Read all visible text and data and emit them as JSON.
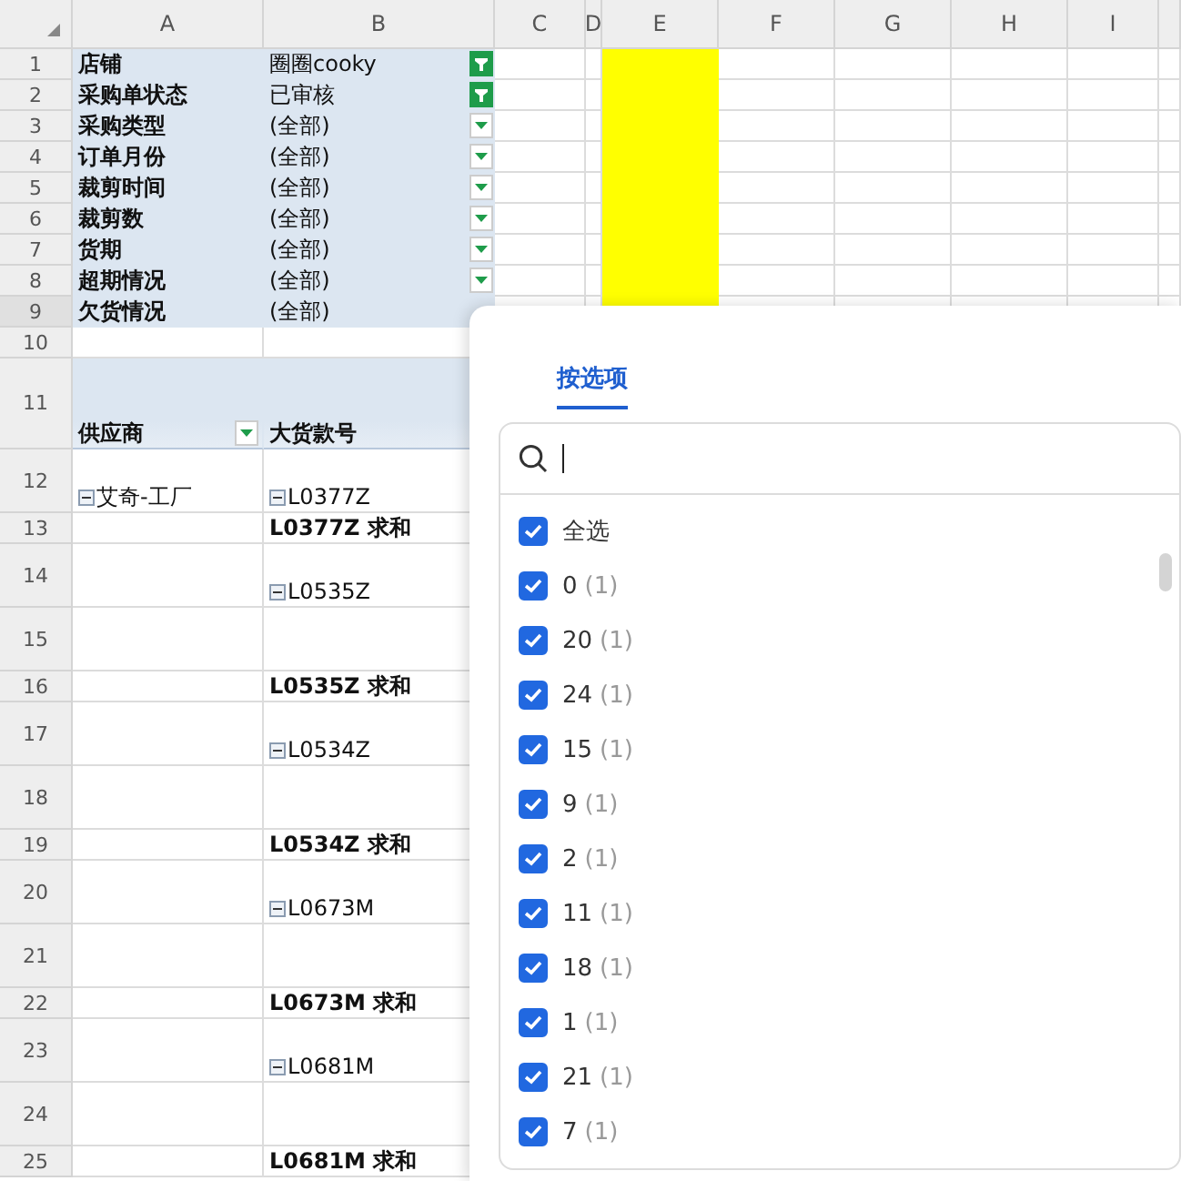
{
  "columns": [
    "A",
    "B",
    "C",
    "D",
    "E",
    "F",
    "G",
    "H",
    "I"
  ],
  "rows": [
    {
      "num": "1",
      "kind": "filter",
      "a": "店铺",
      "b": "圈圈cooky",
      "filtered": true,
      "highlighted": true,
      "selected": false
    },
    {
      "num": "2",
      "kind": "filter",
      "a": "采购单状态",
      "b": "已审核",
      "filtered": true,
      "highlighted": true,
      "selected": false
    },
    {
      "num": "3",
      "kind": "filter",
      "a": "采购类型",
      "b": "(全部)",
      "filtered": false,
      "highlighted": true,
      "selected": false
    },
    {
      "num": "4",
      "kind": "filter",
      "a": "订单月份",
      "b": "(全部)",
      "filtered": false,
      "highlighted": true,
      "selected": false
    },
    {
      "num": "5",
      "kind": "filter",
      "a": "裁剪时间",
      "b": "(全部)",
      "filtered": false,
      "highlighted": true,
      "selected": false
    },
    {
      "num": "6",
      "kind": "filter",
      "a": "裁剪数",
      "b": "(全部)",
      "filtered": false,
      "highlighted": true,
      "selected": false
    },
    {
      "num": "7",
      "kind": "filter",
      "a": "货期",
      "b": "(全部)",
      "filtered": false,
      "highlighted": true,
      "selected": false
    },
    {
      "num": "8",
      "kind": "filter",
      "a": "超期情况",
      "b": "(全部)",
      "filtered": false,
      "highlighted": true,
      "selected": false
    },
    {
      "num": "9",
      "kind": "filter",
      "a": "欠货情况",
      "b": "(全部)",
      "highlighted": true,
      "selected": true
    },
    {
      "num": "10",
      "kind": "blank",
      "selected": false
    },
    {
      "num": "11",
      "kind": "header",
      "a": "供应商",
      "b": "大货款号",
      "selected": false
    },
    {
      "num": "12",
      "kind": "item",
      "a": "艾奇-工厂",
      "b": "L0377Z",
      "selected": false
    },
    {
      "num": "13",
      "kind": "subtotal",
      "b": "L0377Z 求和",
      "selected": false
    },
    {
      "num": "14",
      "kind": "item",
      "b": "L0535Z",
      "selected": false
    },
    {
      "num": "15",
      "kind": "item",
      "selected": false
    },
    {
      "num": "16",
      "kind": "subtotal",
      "b": "L0535Z 求和",
      "selected": false
    },
    {
      "num": "17",
      "kind": "item",
      "b": "L0534Z",
      "selected": false
    },
    {
      "num": "18",
      "kind": "item",
      "selected": false
    },
    {
      "num": "19",
      "kind": "subtotal",
      "b": "L0534Z 求和",
      "selected": false
    },
    {
      "num": "20",
      "kind": "item",
      "b": "L0673M",
      "selected": false
    },
    {
      "num": "21",
      "kind": "item",
      "selected": false
    },
    {
      "num": "22",
      "kind": "subtotal",
      "b": "L0673M 求和",
      "selected": false
    },
    {
      "num": "23",
      "kind": "item",
      "b": "L0681M",
      "selected": false
    },
    {
      "num": "24",
      "kind": "item",
      "selected": false
    },
    {
      "num": "25",
      "kind": "subtotal",
      "b": "L0681M 求和",
      "selected": false
    }
  ],
  "panel": {
    "tab": {
      "label": "按选项",
      "selected": true
    },
    "items": [
      {
        "label": "全选",
        "checked": true
      },
      {
        "label": "0",
        "count": "(1)",
        "checked": true
      },
      {
        "label": "20",
        "count": "(1)",
        "checked": true
      },
      {
        "label": "24",
        "count": "(1)",
        "checked": true
      },
      {
        "label": "15",
        "count": "(1)",
        "checked": true
      },
      {
        "label": "9",
        "count": "(1)",
        "checked": true
      },
      {
        "label": "2",
        "count": "(1)",
        "checked": true
      },
      {
        "label": "11",
        "count": "(1)",
        "checked": true
      },
      {
        "label": "18",
        "count": "(1)",
        "checked": true
      },
      {
        "label": "1",
        "count": "(1)",
        "checked": true
      },
      {
        "label": "21",
        "count": "(1)",
        "checked": true
      },
      {
        "label": "7",
        "count": "(1)",
        "checked": true
      }
    ]
  }
}
